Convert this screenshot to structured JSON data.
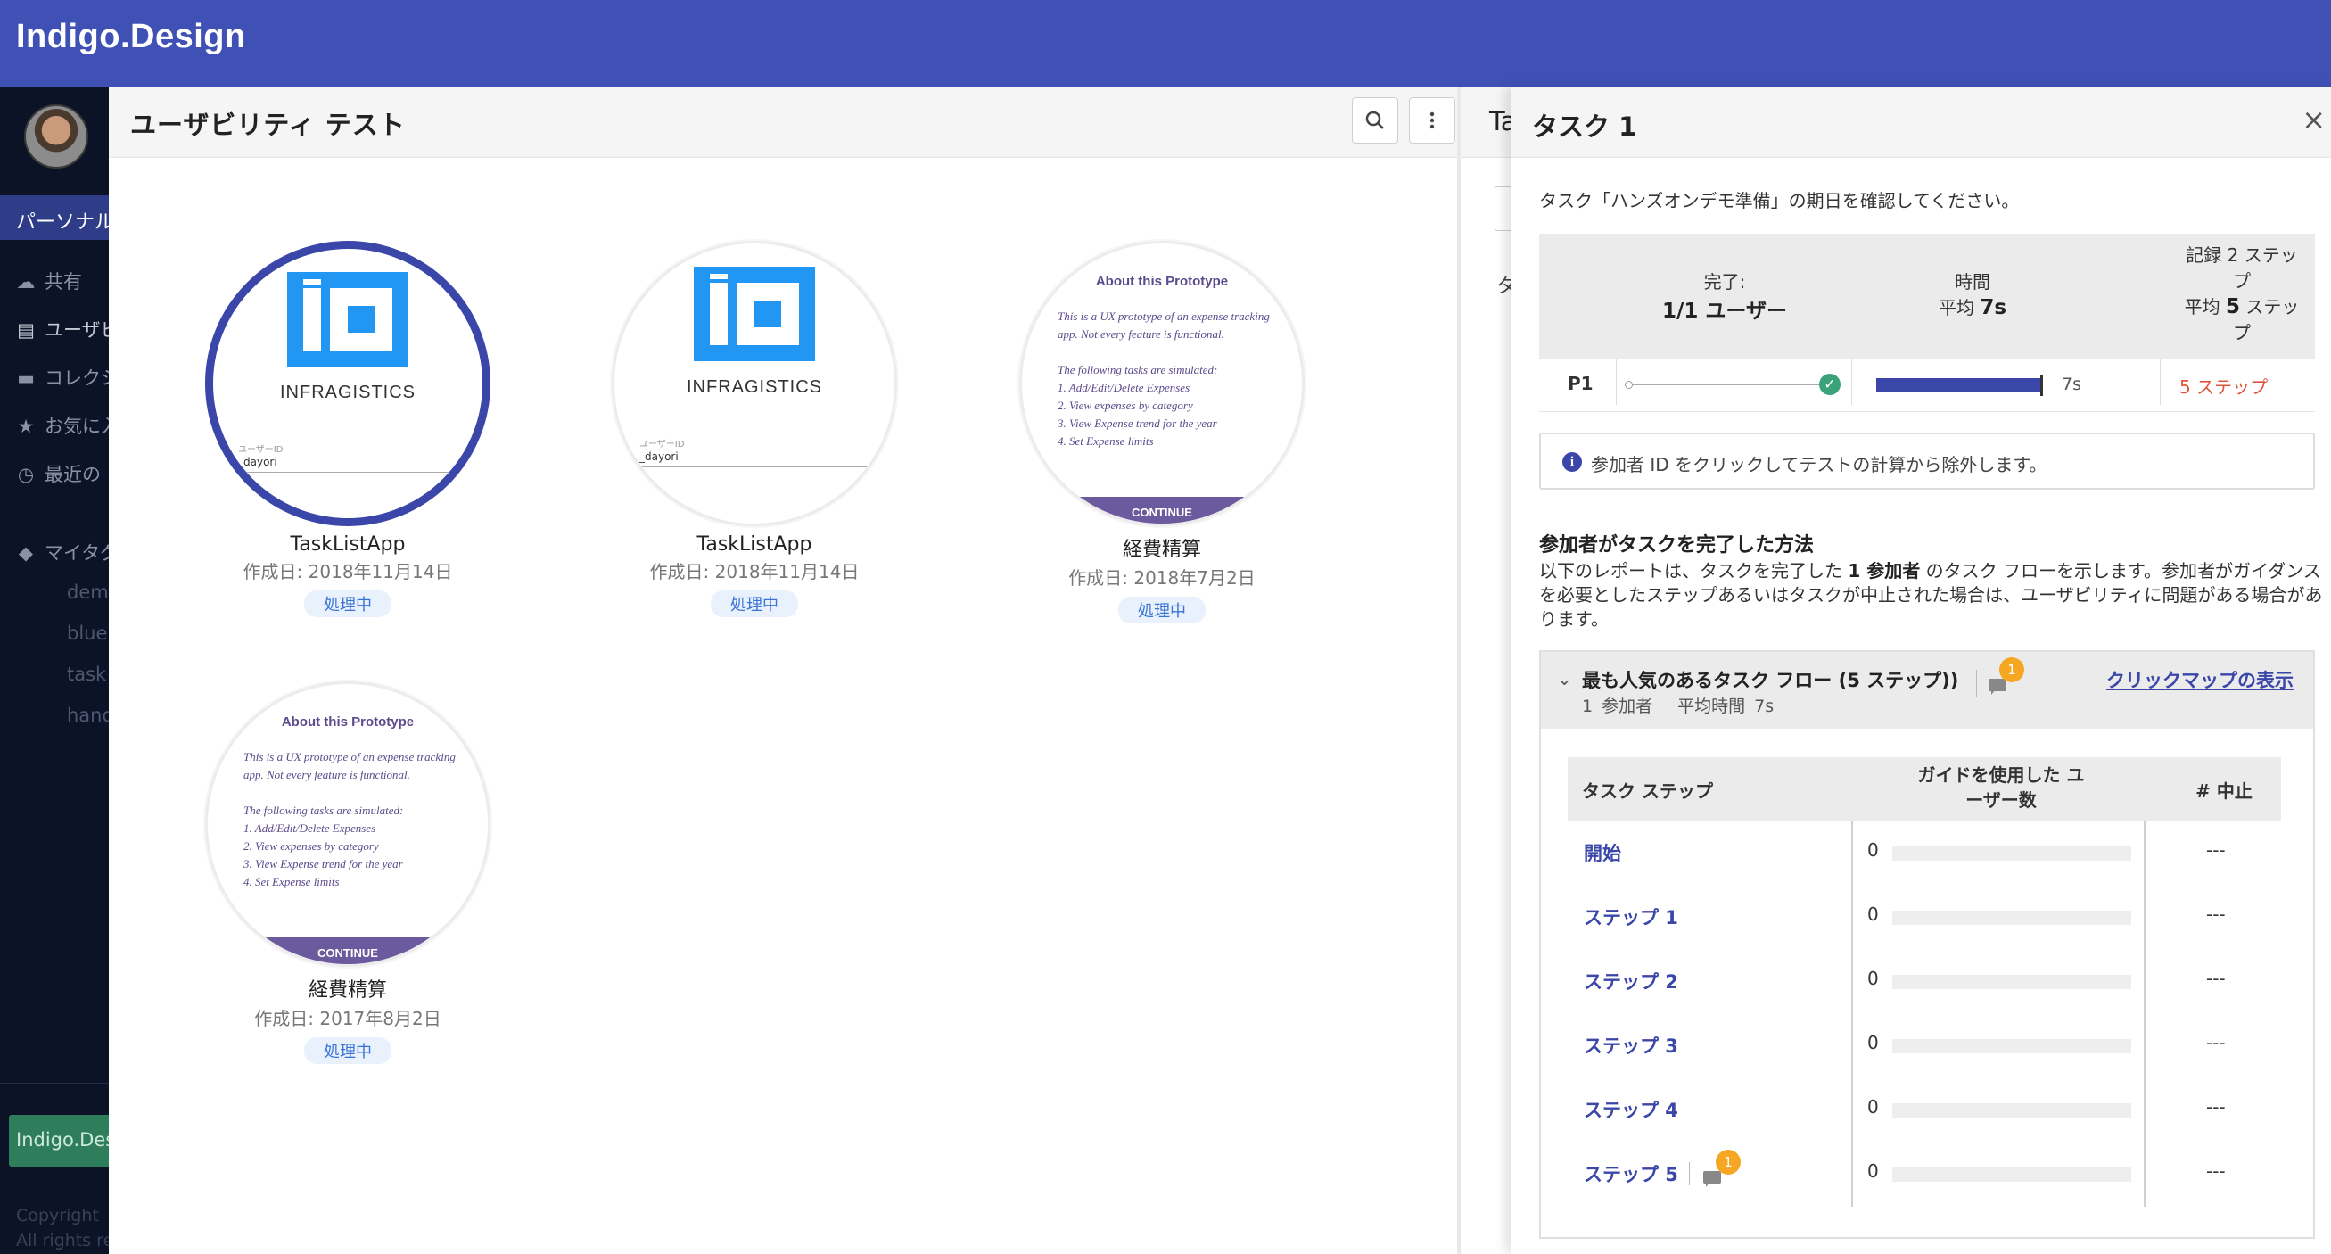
{
  "app": {
    "brand": "Indigo.Design"
  },
  "sidebar": {
    "section": "パーソナル",
    "items": [
      {
        "label": "共有",
        "icon": "cloud-icon"
      },
      {
        "label": "ユーザビリティ",
        "icon": "usability-icon"
      },
      {
        "label": "コレクション",
        "icon": "folder-icon"
      },
      {
        "label": "お気に入り",
        "icon": "star-icon"
      },
      {
        "label": "最近の",
        "icon": "clock-icon"
      }
    ],
    "tags_label": "マイタグ",
    "tags": [
      "demo",
      "blue",
      "task",
      "hands"
    ],
    "footer_button": "Indigo.Design",
    "copyright": [
      "Copyright",
      "All rights reserved"
    ]
  },
  "main": {
    "title": "ユーザビリティ テスト",
    "cards": [
      {
        "name": "TaskListApp",
        "date": "作成日: 2018年11月14日",
        "status": "処理中",
        "kind": "infragistics",
        "logo_text": "INFRAGISTICS",
        "login_label": "ユーザーID",
        "login_value": "_dayori"
      },
      {
        "name": "TaskListApp",
        "date": "作成日: 2018年11月14日",
        "status": "処理中",
        "kind": "infragistics",
        "logo_text": "INFRAGISTICS",
        "login_label": "ユーザーID",
        "login_value": "_dayori"
      },
      {
        "name": "経費精算",
        "date": "作成日: 2018年7月2日",
        "status": "処理中",
        "kind": "prototype",
        "proto_title": "About this Prototype",
        "proto_body": "This is a UX prototype of an expense tracking app. Not every feature is functional.\n\nThe following tasks are simulated:\n1. Add/Edit/Delete Expenses\n2. View expenses by category\n3. View Expense trend for the year\n4. Set Expense limits",
        "proto_button": "CONTINUE"
      },
      {
        "name": "経費精算",
        "date": "作成日: 2017年8月2日",
        "status": "処理中",
        "kind": "prototype",
        "proto_title": "About this Prototype",
        "proto_body": "This is a UX prototype of an expense tracking app. Not every feature is functional.\n\nThe following tasks are simulated:\n1. Add/Edit/Delete Expenses\n2. View expenses by category\n3. View Expense trend for the year\n4. Set Expense limits",
        "proto_button": "CONTINUE"
      }
    ]
  },
  "middle": {
    "title": "Ta",
    "char": "タ"
  },
  "panel": {
    "title": "タスク 1",
    "close": "×",
    "description": "タスク「ハンズオンデモ準備」の期日を確認してください。",
    "stats": {
      "completed_label": "完了:",
      "completed_value": "1/1 ユーザー",
      "time_label": "時間",
      "time_prefix": "平均",
      "time_value": "7s",
      "steps_label": "記録 2 ステップ",
      "steps_avg_prefix": "平均",
      "steps_avg_num": "5",
      "steps_avg_suffix": "ステップ"
    },
    "participant": {
      "id": "P1",
      "time": "7s",
      "steps": "5 ステップ",
      "time_fraction": 1.0
    },
    "info": "参加者 ID をクリックしてテストの計算から除外します。",
    "section_title": "参加者がタスクを完了した方法",
    "section_desc_1": "以下のレポートは、タスクを完了した",
    "section_desc_bold": "1 参加者",
    "section_desc_2": "のタスク フローを示します。参加者がガイダンスを必要としたステップあるいはタスクが中止された場合は、ユーザビリティに問題がある場合があります。",
    "flow": {
      "title": "最も人気のあるタスク フロー (5 ステップ))",
      "participants": "1 参加者",
      "avg_time": "平均時間 7s",
      "comment_count": "1",
      "clickmap_link": "クリックマップの表示"
    },
    "table": {
      "col_step": "タスク ステップ",
      "col_guide": "ガイドを使用した ユーザー数",
      "col_abort": "# 中止",
      "rows": [
        {
          "name": "開始",
          "guided": "0",
          "guided_fraction": 0,
          "aborts": "---"
        },
        {
          "name": "ステップ 1",
          "guided": "0",
          "guided_fraction": 0,
          "aborts": "---"
        },
        {
          "name": "ステップ 2",
          "guided": "0",
          "guided_fraction": 0,
          "aborts": "---"
        },
        {
          "name": "ステップ 3",
          "guided": "0",
          "guided_fraction": 0,
          "aborts": "---"
        },
        {
          "name": "ステップ 4",
          "guided": "0",
          "guided_fraction": 0,
          "aborts": "---"
        },
        {
          "name": "ステップ 5",
          "guided": "0",
          "guided_fraction": 0,
          "aborts": "---",
          "comments": "1"
        }
      ]
    }
  }
}
